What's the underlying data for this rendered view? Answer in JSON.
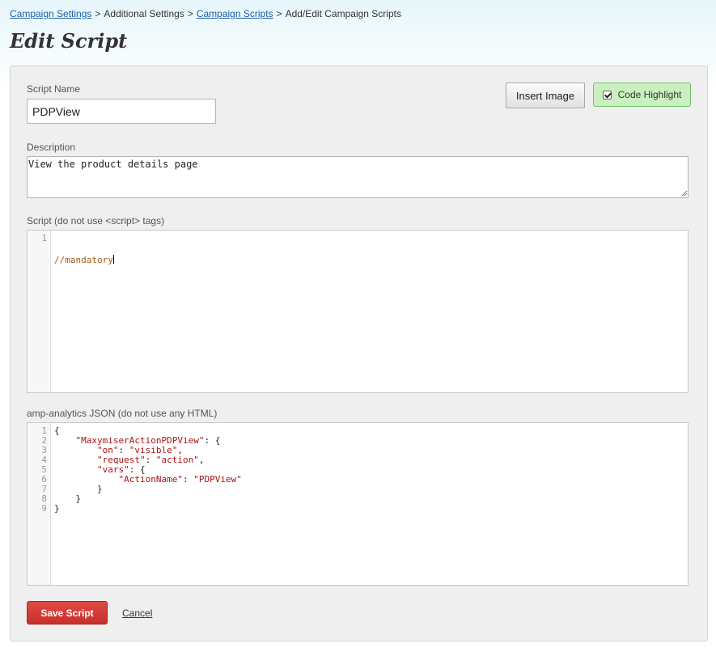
{
  "breadcrumb": {
    "items": [
      "Campaign Settings",
      "Additional Settings",
      "Campaign Scripts",
      "Add/Edit Campaign Scripts"
    ],
    "separator": ">"
  },
  "page": {
    "title": "Edit Script"
  },
  "form": {
    "script_name": {
      "label": "Script Name",
      "value": "PDPView"
    },
    "description": {
      "label": "Description",
      "value": "View the product details page"
    },
    "script": {
      "label": "Script (do not use <script> tags)",
      "line_numbers": [
        "1"
      ],
      "code": "//mandatory"
    },
    "amp_json": {
      "label": "amp-analytics JSON (do not use any HTML)",
      "line_numbers": [
        "1",
        "2",
        "3",
        "4",
        "5",
        "6",
        "7",
        "8",
        "9"
      ],
      "lines": [
        "{",
        "    \"MaxymiserActionPDPView\": {",
        "        \"on\": \"visible\",",
        "        \"request\": \"action\",",
        "        \"vars\": {",
        "            \"ActionName\": \"PDPView\"",
        "        }",
        "    }",
        "}"
      ]
    },
    "insert_image_label": "Insert Image",
    "code_highlight": {
      "label": "Code Highlight",
      "checked": true
    },
    "save_label": "Save Script",
    "cancel_label": "Cancel"
  },
  "colors": {
    "save_button": "#d23a34",
    "code_highlight_bg": "#c8f0c0",
    "link": "#1a5fa8",
    "string_token": "#aa1111",
    "comment_token": "#a05a14"
  }
}
